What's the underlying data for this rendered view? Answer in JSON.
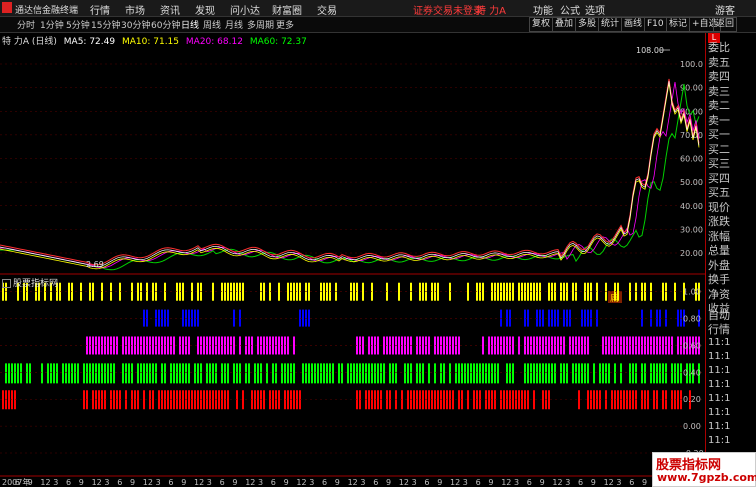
{
  "app": {
    "title": "通达信金融终端"
  },
  "menu": [
    "行情",
    "市场",
    "资讯",
    "发现",
    "问小达",
    "财富圈",
    "交易"
  ],
  "login_alert": "证券交易未登录",
  "stock_name": "特 力A",
  "top_right": [
    "功能",
    "公式",
    "选项",
    "游客"
  ],
  "periods": [
    "分时",
    "1分钟",
    "5分钟",
    "15分钟",
    "30分钟",
    "60分钟",
    "日线",
    "周线",
    "月线",
    "多周期",
    "更多"
  ],
  "active_period": "日线",
  "right_tools": [
    "复权",
    "叠加",
    "多股",
    "统计",
    "画线",
    "F10",
    "标记",
    "+自选",
    "返回"
  ],
  "ma_info": {
    "name": "特 力A (日线)",
    "ma5": "MA5: 72.49",
    "ma10": "MA10: 71.15",
    "ma20": "MA20: 68.12",
    "ma60": "MA60: 72.37"
  },
  "colors": {
    "ma5": "#ffffff",
    "ma10": "#ffff00",
    "ma20": "#ff00ff",
    "ma60": "#00ff00",
    "up": "#ff3030",
    "down": "#00ffff"
  },
  "price_axis": [
    "100.0",
    "90.00",
    "80.00",
    "70.00",
    "60.00",
    "50.00",
    "40.00",
    "30.00",
    "20.00"
  ],
  "high_label": "108.00",
  "low_label": "2.69",
  "marker": "扁",
  "indicator": {
    "title": "股票指标网",
    "axis": [
      "1.00",
      "0.80",
      "0.60",
      "0.40",
      "0.20",
      "0.00",
      "-0.20"
    ],
    "emojis": [
      "😊",
      "😊😊"
    ]
  },
  "x_axis": [
    "2007年",
    "6",
    "9",
    "12",
    "3",
    "6",
    "9",
    "12",
    "3",
    "6",
    "9",
    "12",
    "3",
    "6",
    "9",
    "12",
    "3",
    "6",
    "9",
    "12",
    "3",
    "6",
    "9",
    "12",
    "3",
    "6",
    "9",
    "12",
    "3",
    "6",
    "9",
    "12",
    "3",
    "6",
    "9",
    "12",
    "3",
    "6",
    "9",
    "12",
    "3",
    "6",
    "9",
    "12",
    "3",
    "6",
    "9",
    "12",
    "3",
    "6",
    "9",
    "12",
    "3",
    "4",
    "7"
  ],
  "right_panel": {
    "badge": "L",
    "order_labels": [
      "委比",
      "卖五",
      "卖四",
      "卖三",
      "卖二",
      "卖一",
      "买一",
      "买二",
      "买三",
      "买四",
      "买五",
      "现价",
      "涨跌",
      "涨幅",
      "总量",
      "外盘",
      "换手",
      "净资",
      "收益"
    ],
    "auto_label": "自动",
    "trade_label": "行情",
    "time_ticks": [
      "11:1",
      "11:1",
      "11:1",
      "11:1",
      "11:1",
      "11:1",
      "11:1",
      "11:1"
    ]
  },
  "watermark": {
    "line1": "股票指标网",
    "line2": "www.7gpzb.com"
  },
  "chart_data": {
    "type": "line",
    "title": "",
    "ylim": [
      0,
      110
    ],
    "high": 108.0,
    "low": 2.69,
    "ma": {
      "ma5": 72.49,
      "ma10": 71.15,
      "ma20": 68.12,
      "ma60": 72.37
    }
  }
}
